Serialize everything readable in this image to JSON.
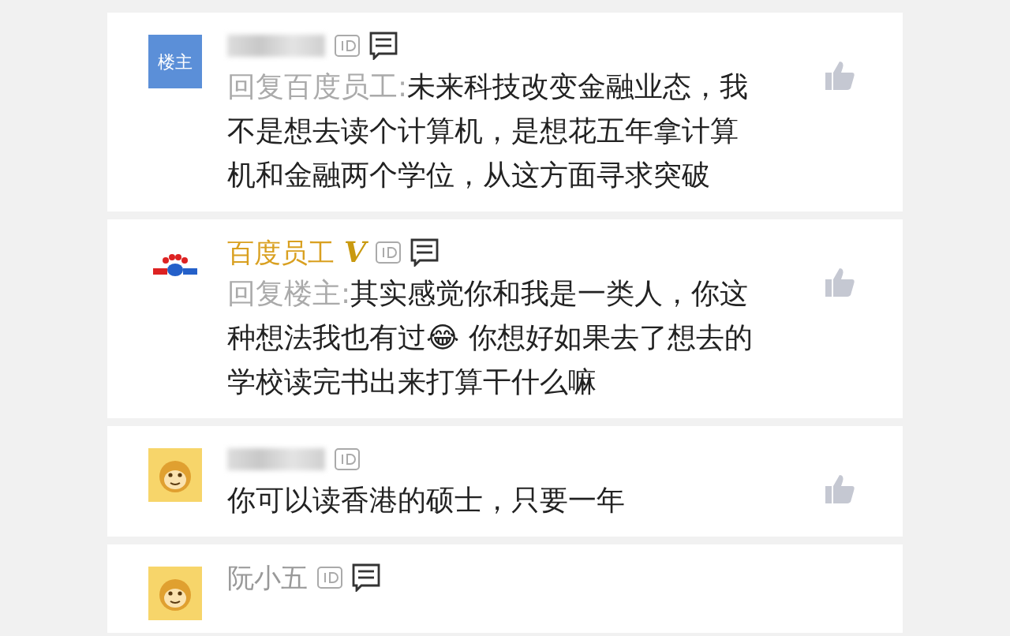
{
  "comments": [
    {
      "avatar": {
        "kind": "label",
        "text": "楼主"
      },
      "note_icon": true,
      "reply_to": "回复百度员工:",
      "text": "未来科技改变金融业态，我不是想去读个计算机，是想花五年拿计算机和金融两个学位，从这方面寻求突破",
      "like": true
    },
    {
      "avatar": {
        "kind": "logo"
      },
      "name": "百度员工",
      "vip": true,
      "verified_mark": "V",
      "note_icon": true,
      "reply_to": "回复楼主:",
      "text": "其实感觉你和我是一类人，你这种想法我也有过😂 你想好如果去了想去的学校读完书出来打算干什么嘛",
      "like": true
    },
    {
      "avatar": {
        "kind": "monkey"
      },
      "note_icon": false,
      "text": "你可以读香港的硕士，只要一年",
      "like": true
    },
    {
      "avatar": {
        "kind": "monkey"
      },
      "name": "阮小五",
      "vip": false,
      "note_icon": true,
      "like": false
    }
  ]
}
